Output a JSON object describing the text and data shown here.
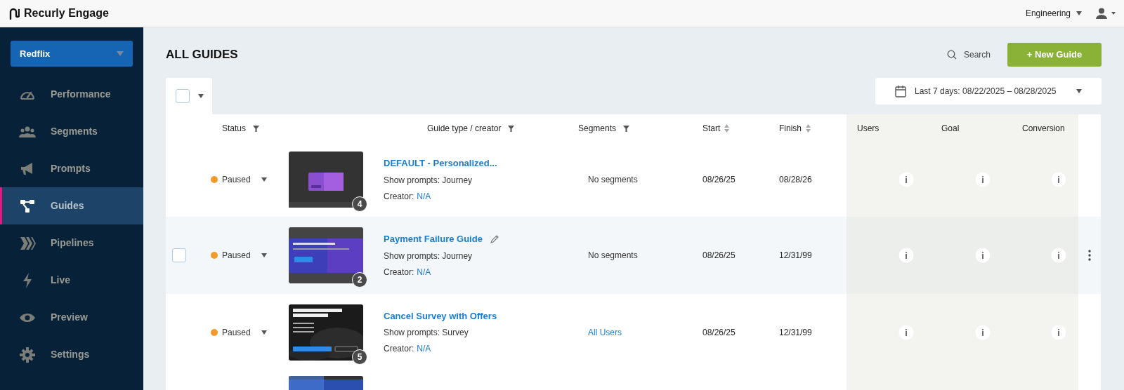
{
  "topbar": {
    "brand": "Recurly Engage",
    "workspace": "Engineering"
  },
  "sidebar": {
    "account": "Redflix",
    "items": [
      {
        "label": "Performance",
        "selected": false
      },
      {
        "label": "Segments",
        "selected": false
      },
      {
        "label": "Prompts",
        "selected": false
      },
      {
        "label": "Guides",
        "selected": true
      },
      {
        "label": "Pipelines",
        "selected": false
      },
      {
        "label": "Live",
        "selected": false
      },
      {
        "label": "Preview",
        "selected": false
      },
      {
        "label": "Settings",
        "selected": false
      }
    ]
  },
  "page": {
    "title": "ALL GUIDES",
    "search": "Search",
    "new_button": "+ New Guide",
    "date_range": "Last 7 days: 08/22/2025 – 08/28/2025",
    "select_all_checked": false
  },
  "table": {
    "columns": [
      {
        "label": "Status",
        "kind": "filter"
      },
      {
        "label": "Guide type / creator",
        "kind": "filter"
      },
      {
        "label": "Segments",
        "kind": "filter"
      },
      {
        "label": "Start",
        "kind": "sort"
      },
      {
        "label": "Finish",
        "kind": "sort"
      },
      {
        "label": "Users",
        "kind": "plain"
      },
      {
        "label": "Goal",
        "kind": "plain"
      },
      {
        "label": "Conversion",
        "kind": "plain"
      }
    ],
    "rows": [
      {
        "kind": "full",
        "hovered": false,
        "checked": false,
        "status": "Paused",
        "color": "#f39a2a",
        "steps": "4",
        "title": "DEFAULT - Personalized...",
        "editable": false,
        "type": "Show prompts: Journey",
        "creator_label": "Creator:",
        "creator": "N/A",
        "segments": "No segments",
        "segments_link": false,
        "start": "08/26/25",
        "finish": "08/28/26"
      },
      {
        "kind": "full",
        "hovered": true,
        "checked": false,
        "status": "Paused",
        "color": "#f39a2a",
        "steps": "2",
        "title": "Payment Failure Guide",
        "editable": true,
        "type": "Show prompts: Journey",
        "creator_label": "Creator:",
        "creator": "N/A",
        "segments": "No segments",
        "segments_link": false,
        "start": "08/26/25",
        "finish": "12/31/99"
      },
      {
        "kind": "full",
        "hovered": false,
        "checked": false,
        "status": "Paused",
        "color": "#f39a2a",
        "steps": "5",
        "title": "Cancel Survey with Offers",
        "editable": false,
        "type": "Show prompts: Survey",
        "creator_label": "Creator:",
        "creator": "N/A",
        "segments": "All Users",
        "segments_link": true,
        "start": "08/26/25",
        "finish": "12/31/99"
      },
      {
        "kind": "cut"
      }
    ]
  }
}
